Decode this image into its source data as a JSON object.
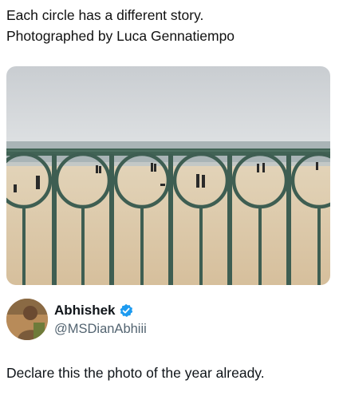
{
  "caption": {
    "line1": "Each circle has a different story.",
    "line2": "Photographed by Luca Gennatiempo"
  },
  "photo": {
    "subject": "beach seen through a railing of circles",
    "colors": {
      "sky": "#d6d9dc",
      "sea": "#a7b3b6",
      "sand": "#ddc9a9",
      "railing": "#3d5f52"
    }
  },
  "author": {
    "display_name": "Abhishek",
    "handle": "@MSDianAbhiii",
    "verified_icon": "verified-badge-icon",
    "verified_color": "#1d9bf0"
  },
  "tweet": {
    "text": "Declare this the photo of the year already."
  }
}
